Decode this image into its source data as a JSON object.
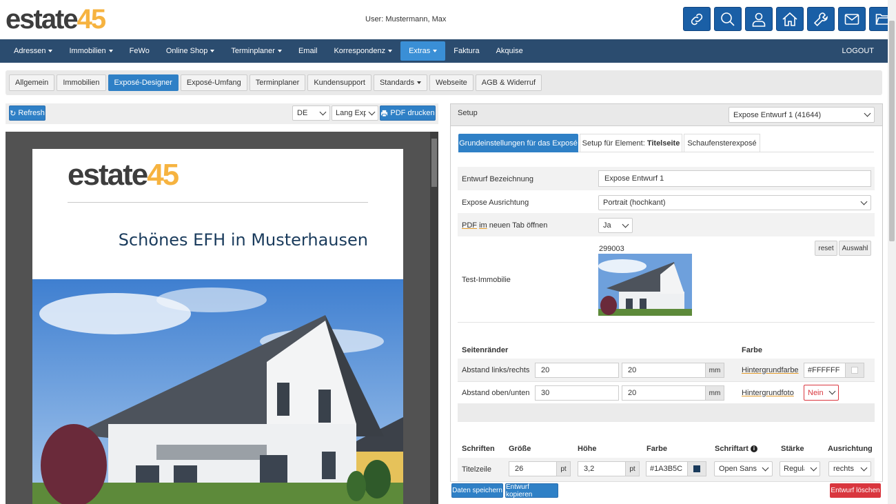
{
  "header": {
    "logo_part1": "estate",
    "logo_part2": "45",
    "user": "User: Mustermann, Max",
    "icons": [
      "link-icon",
      "search-icon",
      "user-icon",
      "home-icon",
      "wrench-icon",
      "mail-icon",
      "folder-icon"
    ]
  },
  "nav": {
    "items": [
      {
        "label": "Adressen",
        "caret": true
      },
      {
        "label": "Immobilien",
        "caret": true
      },
      {
        "label": "FeWo",
        "caret": false
      },
      {
        "label": "Online Shop",
        "caret": true
      },
      {
        "label": "Terminplaner",
        "caret": true
      },
      {
        "label": "Email",
        "caret": false
      },
      {
        "label": "Korrespondenz",
        "caret": true
      },
      {
        "label": "Extras",
        "caret": true,
        "active": true
      },
      {
        "label": "Faktura",
        "caret": false
      },
      {
        "label": "Akquise",
        "caret": false
      }
    ],
    "logout": "LOGOUT"
  },
  "tabs": [
    "Allgemein",
    "Immobilien",
    "Exposé-Designer",
    "Exposé-Umfang",
    "Terminplaner",
    "Kundensupport",
    "Standards",
    "Webseite",
    "AGB & Widerruf"
  ],
  "active_tab": "Exposé-Designer",
  "left_toolbar": {
    "refresh": "Refresh",
    "lang": "DE",
    "expose_type": "Lang Expo",
    "pdf": "PDF drucken"
  },
  "preview": {
    "logo_part1": "estate",
    "logo_part2": "45",
    "title": "Schönes EFH in Musterhausen"
  },
  "setup": {
    "label": "Setup",
    "select": "Expose Entwurf 1 (41644)",
    "subtabs": {
      "t1": "Grundeinstellungen für das Exposé",
      "t2_prefix": "Setup für Element: ",
      "t2_bold": "Titelseite",
      "t3": "Schaufensterexposé"
    },
    "entwurf_label": "Entwurf Bezeichnung",
    "entwurf_value": "Expose Entwurf 1",
    "ausrichtung_label": "Expose Ausrichtung",
    "ausrichtung_value": "Portrait (hochkant)",
    "pdf_tab_label_1": "PDF",
    "pdf_tab_label_2": "im",
    "pdf_tab_label_3": "neuen Tab öffnen",
    "pdf_tab_value": "Ja",
    "test_label": "Test-Immobilie",
    "test_id": "299003",
    "reset": "reset",
    "auswahl": "Auswahl",
    "seitenraender": "Seitenränder",
    "farbe": "Farbe",
    "abstand_lr": "Abstand links/rechts",
    "abstand_lr_v1": "20",
    "abstand_lr_v2": "20",
    "abstand_ou": "Abstand oben/unten",
    "abstand_ou_v1": "30",
    "abstand_ou_v2": "20",
    "mm": "mm",
    "hintergrundfarbe": "Hintergrundfarbe",
    "hintergrundfarbe_value": "#FFFFFF",
    "hintergrundfoto": "Hintergrundfoto",
    "hintergrundfoto_value": "Nein",
    "fonts_headers": {
      "schriften": "Schriften",
      "groesse": "Größe",
      "hoehe": "Höhe",
      "farbe": "Farbe",
      "schriftart": "Schriftart",
      "staerke": "Stärke",
      "ausrichtung": "Ausrichtung"
    },
    "titelzeile": {
      "label": "Titelzeile",
      "size": "26",
      "pt": "pt",
      "height": "3,2",
      "color": "#1A3B5C",
      "font": "Open Sans (",
      "weight": "Regula",
      "align": "rechts"
    }
  },
  "footer": {
    "save": "Daten speichern",
    "copy": "Entwurf kopieren",
    "delete": "Entwurf löschen"
  },
  "colors": {
    "nav": "#2b4c6f",
    "accent": "#2f80c6",
    "logo_orange": "#f6b340",
    "title_color": "#1a3b5c",
    "danger": "#d9363e"
  }
}
